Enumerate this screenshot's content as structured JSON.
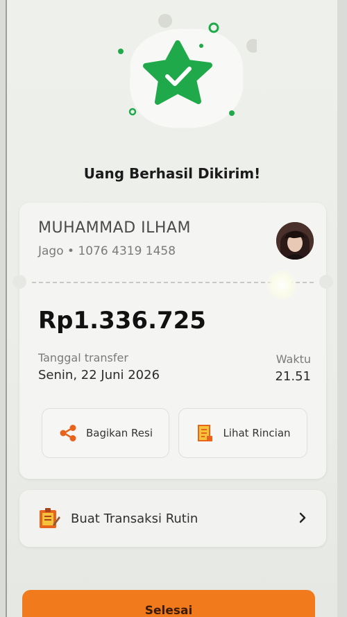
{
  "success_title": "Uang Berhasil Dikirim!",
  "recipient": {
    "name": "MUHAMMAD ILHAM",
    "bank_account": "Jago • 1076 4319 1458"
  },
  "transfer": {
    "amount": "Rp1.336.725",
    "date_label": "Tanggal transfer",
    "date_value": "Senin, 22 Juni 2026",
    "time_label": "Waktu",
    "time_value": "21.51"
  },
  "actions": {
    "share_label": "Bagikan Resi",
    "detail_label": "Lihat Rincian"
  },
  "routine": {
    "label": "Buat Transaksi Rutin"
  },
  "done_label": "Selesai",
  "colors": {
    "success_green": "#1fa94a",
    "primary_orange": "#f07a1c",
    "icon_orange": "#e8641c"
  },
  "icons": {
    "hero": "star-check-icon",
    "share": "share-icon",
    "detail": "receipt-icon",
    "routine": "clipboard-icon",
    "chevron": "chevron-right-icon"
  }
}
